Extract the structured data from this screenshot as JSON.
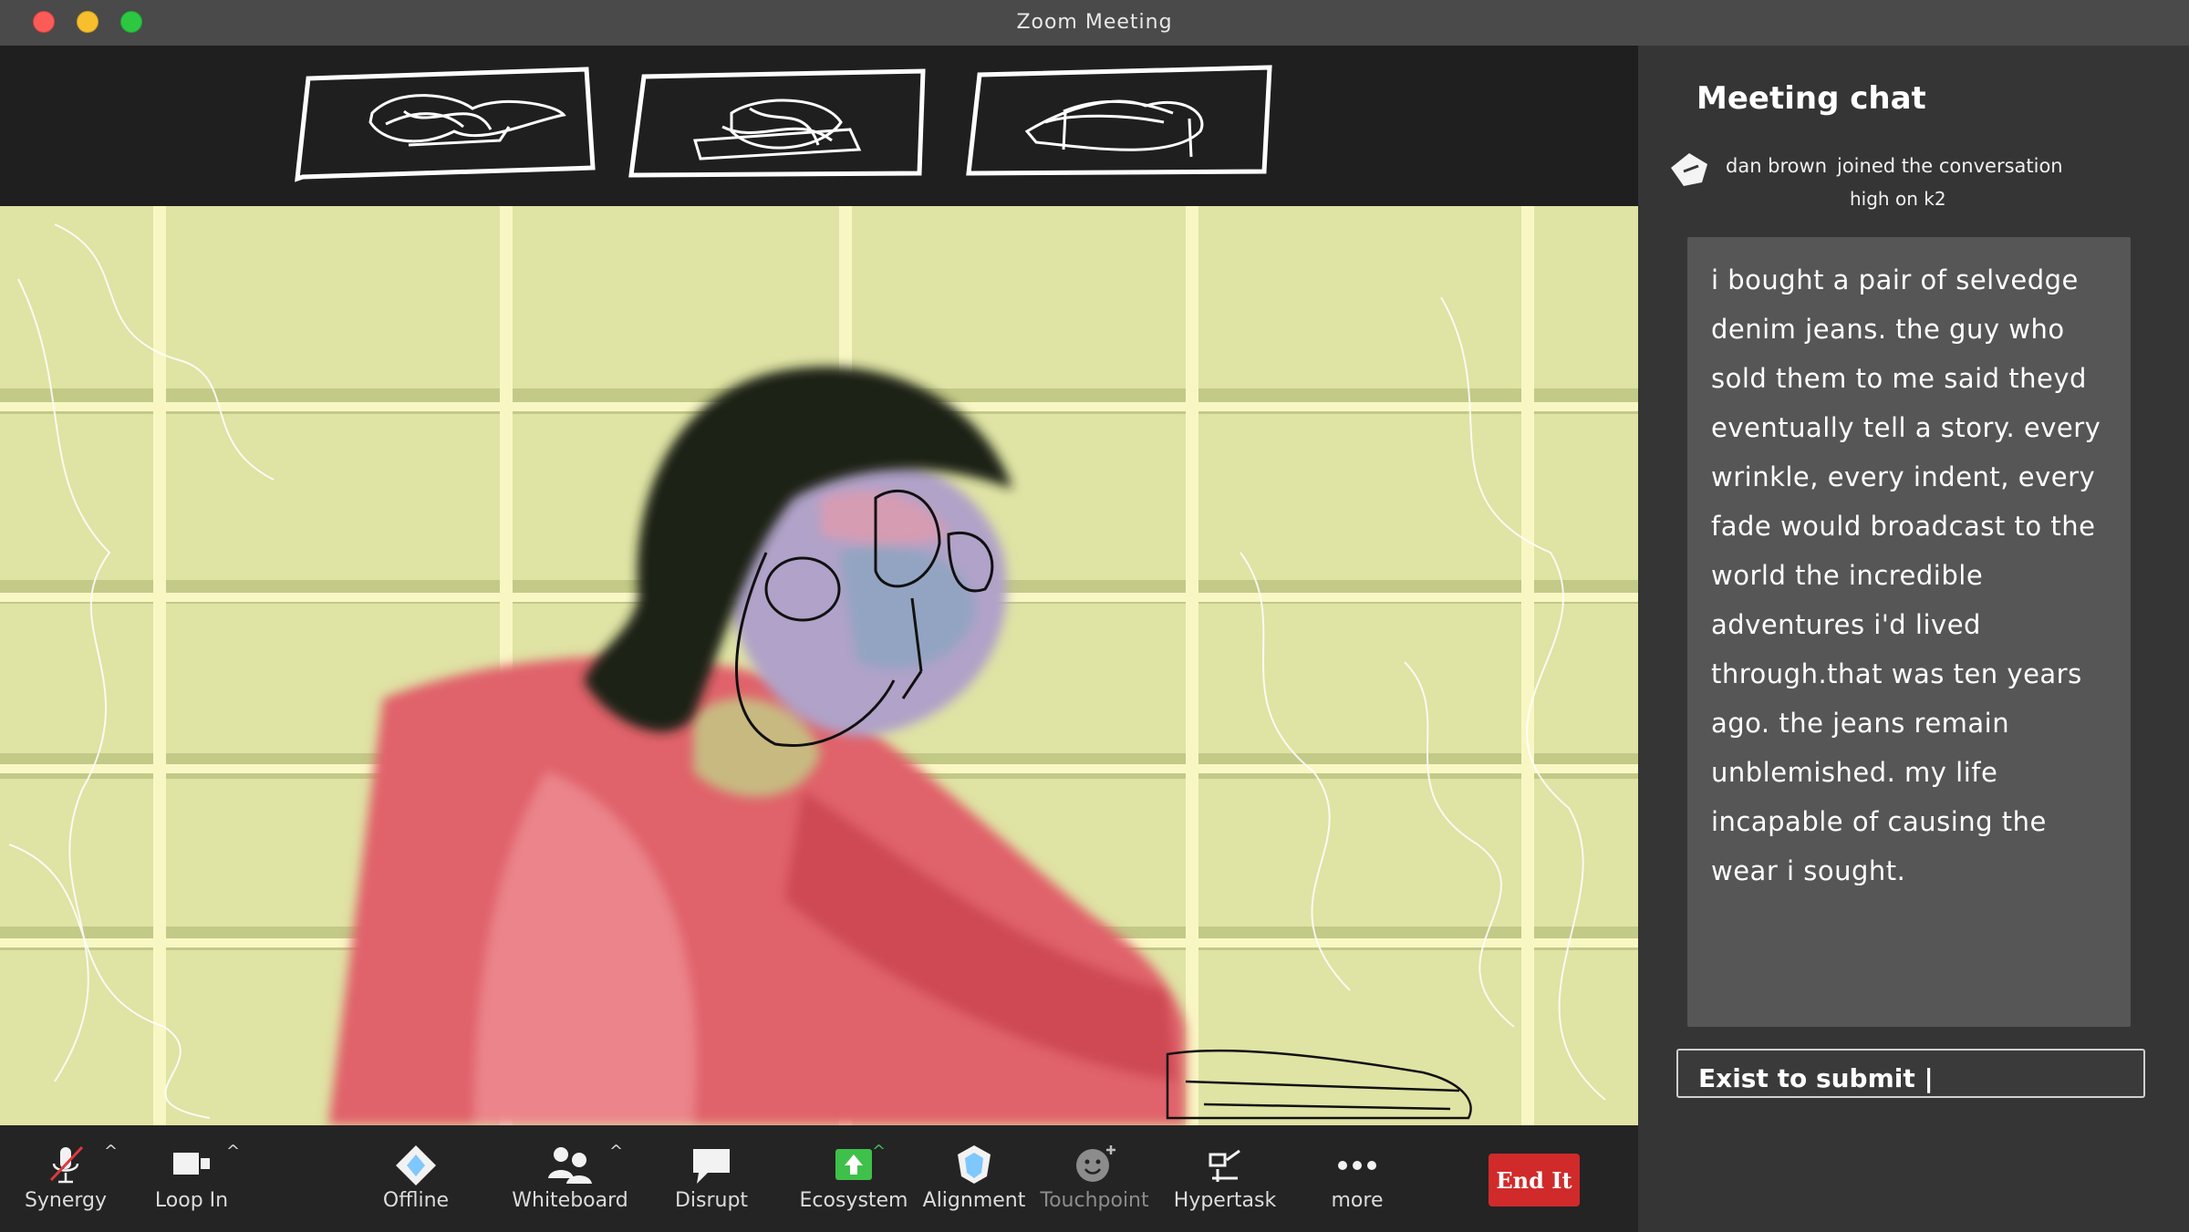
{
  "window": {
    "title": "Zoom Meeting"
  },
  "chat": {
    "title": "Meeting chat",
    "join_user": "dan brown",
    "join_text": "joined the conversation",
    "join_sub": "high on k2",
    "message": "i bought a pair of selvedge denim jeans. the guy who sold them to me said theyd eventually tell a story. every wrinkle, every indent, every fade would broadcast to the world the incredible adventures i'd lived through.that was ten years ago. the jeans remain unblemished. my life incapable of causing the wear i sought.",
    "input_value": "Exist to submit |"
  },
  "toolbar": {
    "synergy": "Synergy",
    "loop_in": "Loop In",
    "offline": "Offline",
    "whiteboard": "Whiteboard",
    "disrupt": "Disrupt",
    "ecosystem": "Ecosystem",
    "alignment": "Alignment",
    "touchpoint": "Touchpoint",
    "hypertask": "Hypertask",
    "more": "more",
    "end": "End It"
  },
  "colors": {
    "end_button": "#d12a2a",
    "wall": "#dfe3a4",
    "shirt": "#e0626a",
    "ecosystem_icon": "#3fc04a",
    "alignment_icon": "#7ec7ff"
  },
  "icons": {
    "synergy": "muted-microphone-icon",
    "loop_in": "video-camera-icon",
    "offline": "diamond-share-icon",
    "whiteboard": "participants-icon",
    "disrupt": "speech-bubble-icon",
    "ecosystem": "green-upload-icon",
    "alignment": "shield-badge-icon",
    "touchpoint": "smiley-plus-icon",
    "hypertask": "apps-icon",
    "more": "ellipsis-icon"
  }
}
